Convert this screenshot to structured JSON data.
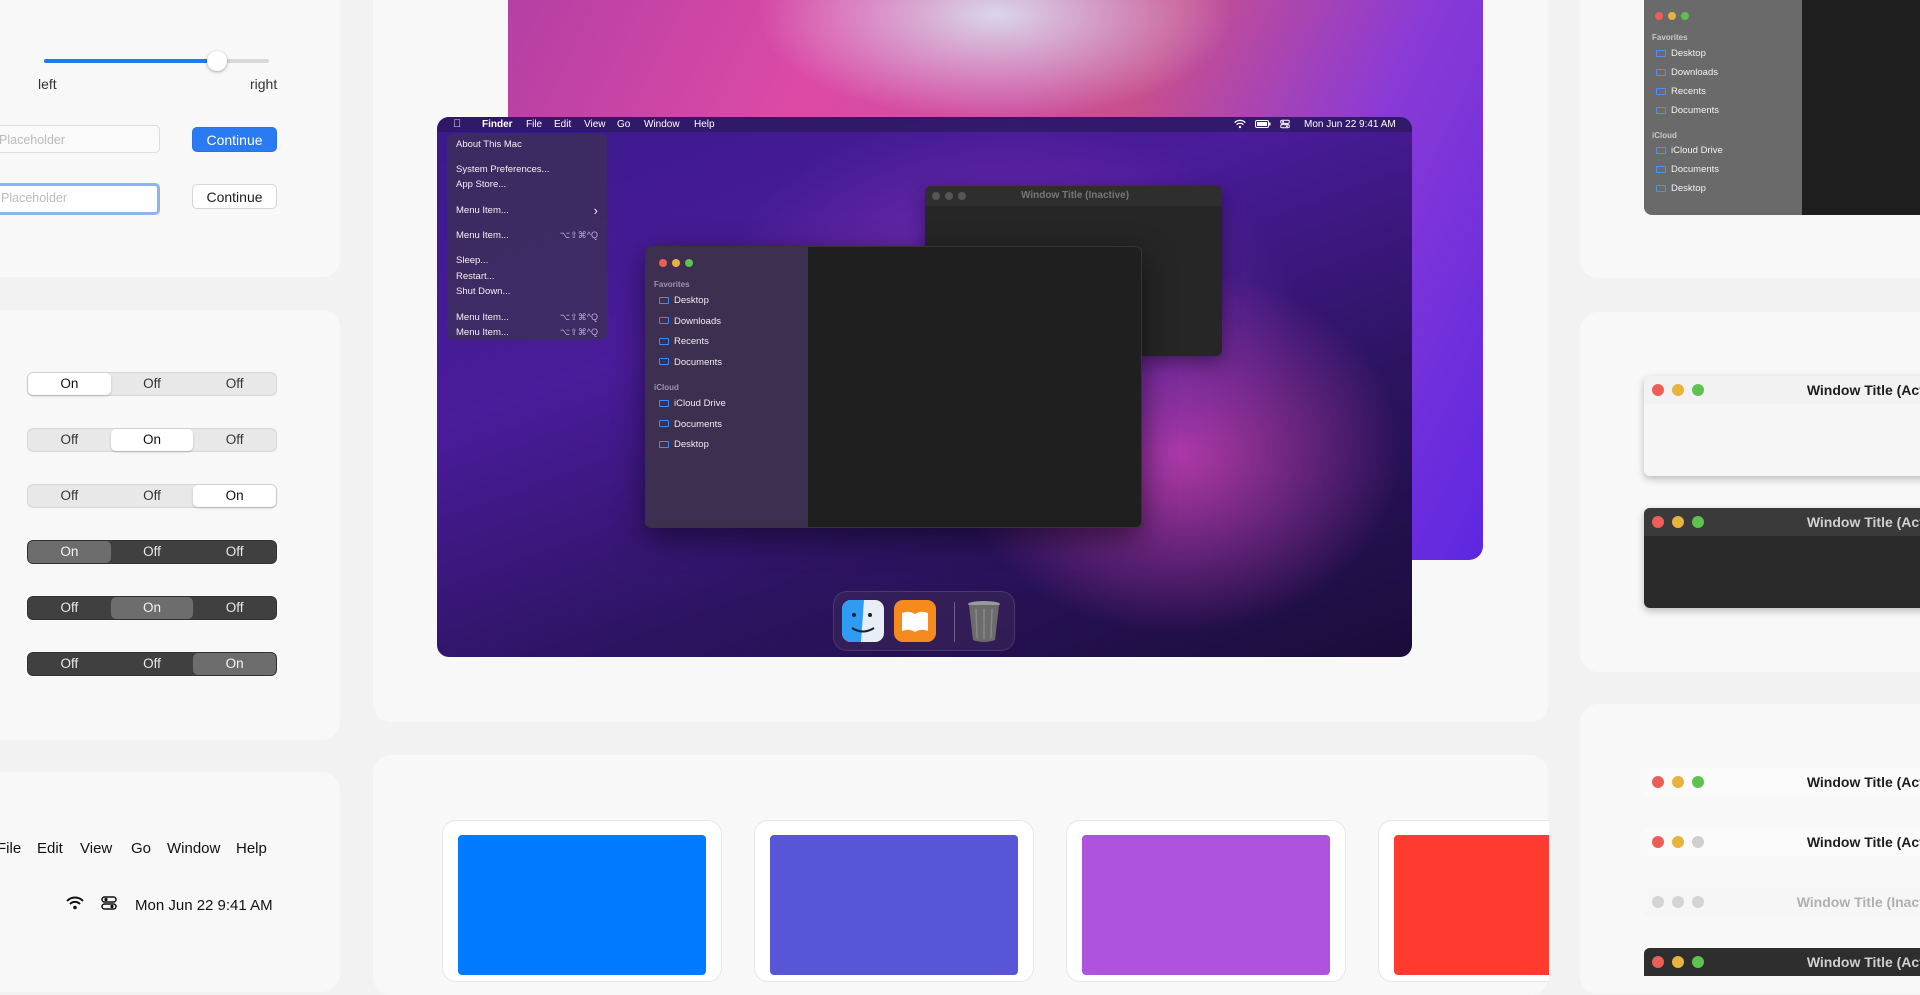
{
  "controls": {
    "slider": {
      "value": 0.77,
      "left_label": "left",
      "right_label": "right"
    },
    "textfield1_placeholder": "Placeholder",
    "textfield2_placeholder": "Placeholder",
    "continue_primary": "Continue",
    "continue_plain": "Continue"
  },
  "segmented": [
    {
      "theme": "light",
      "options": [
        "On",
        "Off",
        "Off"
      ],
      "selected": 0
    },
    {
      "theme": "light",
      "options": [
        "Off",
        "On",
        "Off"
      ],
      "selected": 1
    },
    {
      "theme": "light",
      "options": [
        "Off",
        "Off",
        "On"
      ],
      "selected": 2
    },
    {
      "theme": "dark",
      "options": [
        "On",
        "Off",
        "Off"
      ],
      "selected": 0
    },
    {
      "theme": "dark",
      "options": [
        "Off",
        "On",
        "Off"
      ],
      "selected": 1
    },
    {
      "theme": "dark",
      "options": [
        "Off",
        "Off",
        "On"
      ],
      "selected": 2
    }
  ],
  "menubar_sample": {
    "items": [
      "File",
      "Edit",
      "View",
      "Go",
      "Window",
      "Help"
    ],
    "datetime": "Mon Jun 22  9:41 AM"
  },
  "desktop": {
    "menubar": {
      "app": "Finder",
      "items": [
        "File",
        "Edit",
        "View",
        "Go",
        "Window",
        "Help"
      ],
      "datetime": "Mon Jun 22  9:41 AM"
    },
    "apple_menu": {
      "items": [
        {
          "label": "About This Mac",
          "shortcut": ""
        },
        {
          "label": "System Preferences...",
          "shortcut": ""
        },
        {
          "label": "App Store...",
          "shortcut": ""
        },
        {
          "label": "Menu Item...",
          "shortcut": "›"
        },
        {
          "label": "Menu Item...",
          "shortcut": "⌥⇧⌘^Q"
        },
        {
          "label": "Sleep...",
          "shortcut": ""
        },
        {
          "label": "Restart...",
          "shortcut": ""
        },
        {
          "label": "Shut Down...",
          "shortcut": ""
        },
        {
          "label": "Menu Item...",
          "shortcut": "⌥⇧⌘^Q"
        },
        {
          "label": "Menu Item...",
          "shortcut": "⌥⇧⌘^Q"
        }
      ]
    },
    "inactive_window_title": "Window Title (Inactive)",
    "finder_sidebar": {
      "favorites_heading": "Favorites",
      "favorites": [
        "Desktop",
        "Downloads",
        "Recents",
        "Documents"
      ],
      "icloud_heading": "iCloud",
      "icloud": [
        "iCloud Drive",
        "Documents",
        "Desktop"
      ]
    },
    "dock": [
      "finder-icon",
      "books-icon",
      "trash-icon"
    ]
  },
  "right_sidebar": {
    "favorites_heading": "Favorites",
    "favorites": [
      "Desktop",
      "Downloads",
      "Recents",
      "Documents"
    ],
    "icloud_heading": "iCloud",
    "icloud": [
      "iCloud Drive",
      "Documents",
      "Desktop"
    ]
  },
  "title_windows": [
    {
      "title": "Window Title (Active)",
      "theme": "light"
    },
    {
      "title": "Window Title (Active)",
      "theme": "dark"
    },
    {
      "title": "Window Title (Active)",
      "theme": "light-bar"
    },
    {
      "title": "Window Title (Active)",
      "theme": "light-bar-disabled-zoom"
    },
    {
      "title": "Window Title (Inactive)",
      "theme": "inactive"
    },
    {
      "title": "Window Title (Active)",
      "theme": "dark-bar"
    }
  ],
  "colors": {
    "traffic_red": "#ec5f57",
    "traffic_yellow": "#e8b23e",
    "traffic_green": "#5fc150",
    "swatches": [
      "#007aff",
      "#5856d6",
      "#af52de",
      "#ff3b30"
    ]
  }
}
